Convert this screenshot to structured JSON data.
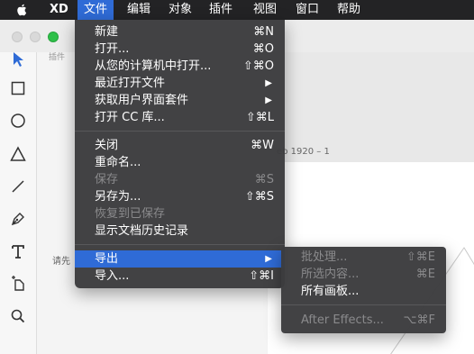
{
  "menubar": {
    "apple_icon": "apple-logo-icon",
    "items": [
      {
        "label": "XD"
      },
      {
        "label": "文件"
      },
      {
        "label": "编辑"
      },
      {
        "label": "对象"
      },
      {
        "label": "插件"
      },
      {
        "label": "视图"
      },
      {
        "label": "窗口"
      },
      {
        "label": "帮助"
      }
    ],
    "active_item": "文件"
  },
  "file_menu": {
    "items": [
      {
        "label": "新建",
        "shortcut": "⌘N"
      },
      {
        "label": "打开...",
        "shortcut": "⌘O"
      },
      {
        "label": "从您的计算机中打开...",
        "shortcut": "⇧⌘O"
      },
      {
        "label": "最近打开文件",
        "submenu": true
      },
      {
        "label": "获取用户界面套件",
        "submenu": true
      },
      {
        "label": "打开 CC 库...",
        "shortcut": "⇧⌘L"
      },
      {
        "label": "关闭",
        "shortcut": "⌘W"
      },
      {
        "label": "重命名..."
      },
      {
        "label": "保存",
        "shortcut": "⌘S",
        "disabled": true
      },
      {
        "label": "另存为...",
        "shortcut": "⇧⌘S"
      },
      {
        "label": "恢复到已保存",
        "disabled": true
      },
      {
        "label": "显示文档历史记录"
      },
      {
        "label": "导出",
        "submenu": true,
        "highlighted": true
      },
      {
        "label": "导入...",
        "shortcut": "⇧⌘I"
      }
    ]
  },
  "export_menu": {
    "items": [
      {
        "label": "批处理...",
        "shortcut": "⇧⌘E",
        "disabled": true
      },
      {
        "label": "所选内容...",
        "shortcut": "⌘E",
        "disabled": true
      },
      {
        "label": "所有画板...",
        "disabled": false
      },
      {
        "label": "After Effects...",
        "shortcut": "⌥⌘F",
        "disabled": true
      }
    ]
  },
  "window": {
    "panel_tab_label": "插件",
    "panel_hint": "请先",
    "artboard_label": "eb 1920 – 1"
  },
  "colors": {
    "menubar_bg": "#232325",
    "menu_highlight": "#2f6bd6",
    "menu_bg": "#3c3c3e",
    "select_tool": "#2f6bd6"
  }
}
